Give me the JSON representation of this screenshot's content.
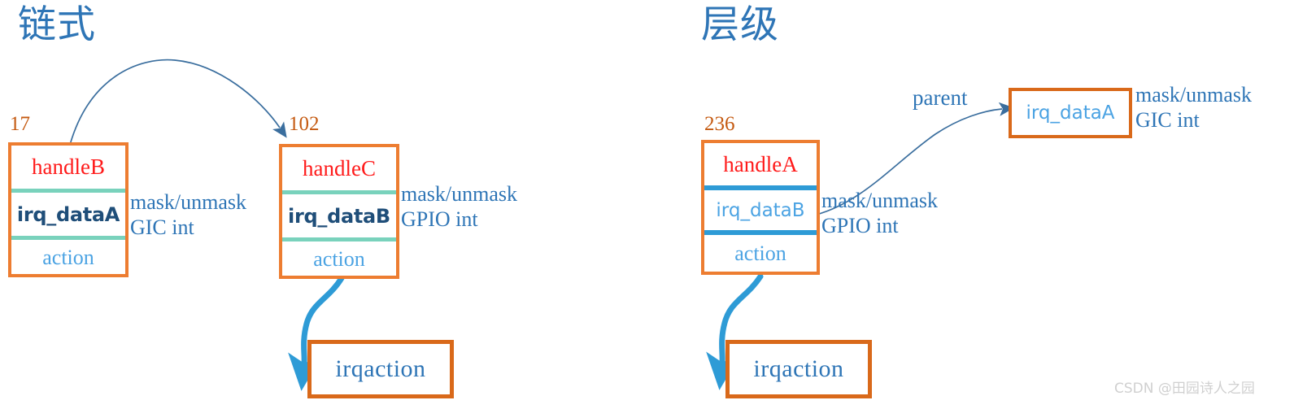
{
  "sections": [
    {
      "id": "chained",
      "title": "链式"
    },
    {
      "id": "hierarchy",
      "title": "层级"
    }
  ],
  "chained": {
    "title": "链式",
    "irq_label_left": "17",
    "irq_label_right": "102",
    "box_left": {
      "handle": "handleB",
      "irq_data": "irq_dataA",
      "action": "action"
    },
    "box_right": {
      "handle": "handleC",
      "irq_data": "irq_dataB",
      "action": "action"
    },
    "annot_left": {
      "line1": "mask/unmask",
      "line2": "GIC int"
    },
    "annot_right": {
      "line1": "mask/unmask",
      "line2": "GPIO int"
    },
    "irqaction": "irqaction"
  },
  "hierarchy": {
    "title": "层级",
    "irq_label": "236",
    "box_main": {
      "handle": "handleA",
      "irq_data": "irq_dataB",
      "action": "action"
    },
    "box_parent": {
      "irq_data": "irq_dataA"
    },
    "parent_link_label": "parent",
    "annot_main": {
      "line1": "mask/unmask",
      "line2": "GPIO int"
    },
    "annot_parent": {
      "line1": "mask/unmask",
      "line2": "GIC int"
    },
    "irqaction": "irqaction"
  },
  "watermark": "CSDN @田园诗人之园",
  "colors": {
    "title_blue": "#2E75B6",
    "irq_number_orange": "#C55A11",
    "box_border_orange": "#ED7D31",
    "plain_box_orange": "#D9691A",
    "handle_red": "#FF1A1A",
    "irqdata_dark_blue": "#1F4E79",
    "irqdata_light_blue": "#4BA3E3",
    "divider_teal": "#79D2BC",
    "divider_blue": "#2E9BD6",
    "thin_arrow_blue": "#3A6E9E",
    "thick_arrow_blue": "#2E9BD6",
    "watermark_gray": "#D0D0D0"
  }
}
